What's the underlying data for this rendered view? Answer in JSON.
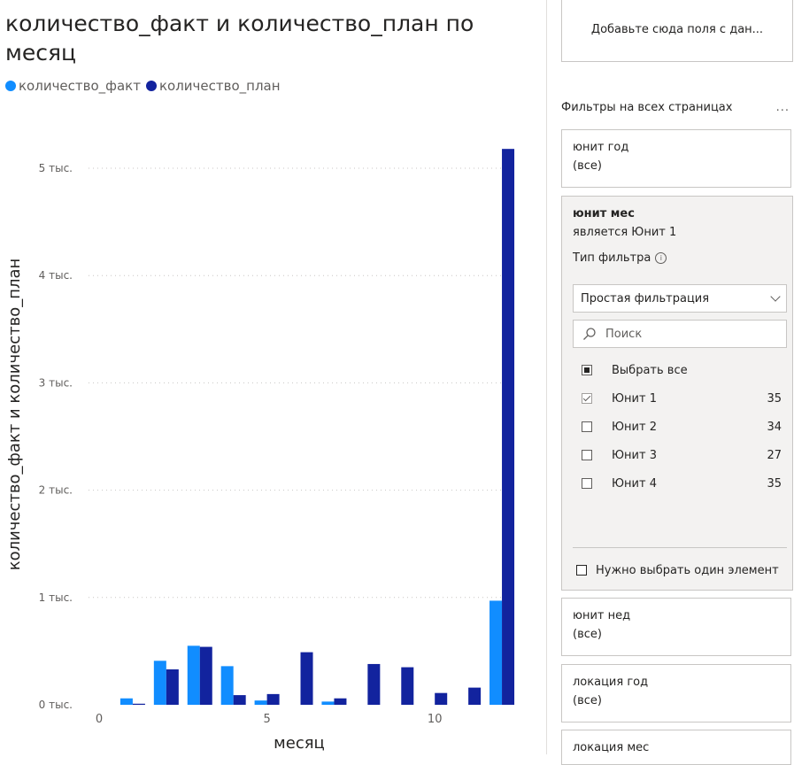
{
  "chart": {
    "title": "количество_факт и количество_план по месяц",
    "legend": [
      {
        "label": "количество_факт",
        "color": "#118DFF"
      },
      {
        "label": "количество_план",
        "color": "#12239E"
      }
    ]
  },
  "chart_data": {
    "type": "bar",
    "title": "количество_факт и количество_план по месяц",
    "xlabel": "месяц",
    "ylabel": "количество_факт и количество_план",
    "x": [
      1,
      2,
      3,
      4,
      5,
      6,
      7,
      8,
      9,
      10,
      11,
      12
    ],
    "x_ticks": [
      "0",
      "5",
      "10"
    ],
    "y_ticks": [
      "0 тыс.",
      "1 тыс.",
      "2 тыс.",
      "3 тыс.",
      "4 тыс.",
      "5 тыс."
    ],
    "xlim": [
      0,
      12.5
    ],
    "ylim": [
      0,
      5200
    ],
    "grid": true,
    "legend_position": "top-left",
    "series": [
      {
        "name": "количество_факт",
        "color": "#118DFF",
        "values": [
          60,
          410,
          550,
          360,
          40,
          0,
          30,
          0,
          0,
          0,
          0,
          970
        ]
      },
      {
        "name": "количество_план",
        "color": "#12239E",
        "values": [
          10,
          330,
          540,
          90,
          100,
          490,
          60,
          380,
          350,
          110,
          160,
          5180
        ]
      }
    ]
  },
  "filters": {
    "drop_zone": "Добавьте сюда поля с дан...",
    "section_title": "Фильтры на всех страницах",
    "more": "...",
    "unit_year": {
      "name": "юнит год",
      "value": "(все)"
    },
    "unit_month": {
      "name": "юнит мес",
      "summary": "является Юнит 1",
      "filter_type_label": "Тип фильтра",
      "filter_type_value": "Простая фильтрация",
      "search_placeholder": "Поиск",
      "select_all": "Выбрать все",
      "options": [
        {
          "label": "Юнит 1",
          "count": "35",
          "checked": true
        },
        {
          "label": "Юнит 2",
          "count": "34",
          "checked": false
        },
        {
          "label": "Юнит 3",
          "count": "27",
          "checked": false
        },
        {
          "label": "Юнит 4",
          "count": "35",
          "checked": false
        }
      ],
      "single_select": "Нужно выбрать один элемент"
    },
    "unit_week": {
      "name": "юнит нед",
      "value": "(все)"
    },
    "loc_year": {
      "name": "локация год",
      "value": "(все)"
    },
    "loc_month": {
      "name": "локация мес"
    }
  }
}
